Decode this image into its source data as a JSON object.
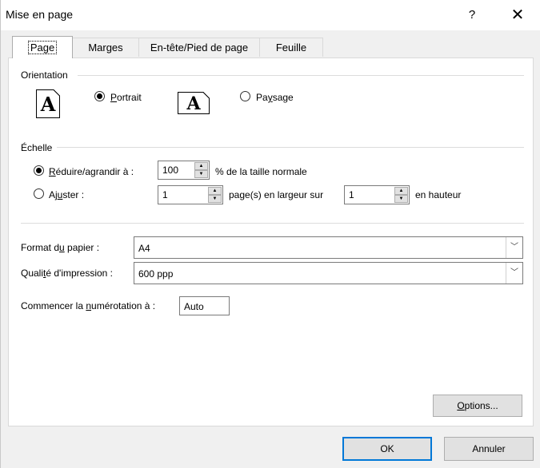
{
  "dialog": {
    "title": "Mise en page",
    "help_label": "?",
    "close_label": "✕"
  },
  "tabs": [
    {
      "label": "Page",
      "selected": true
    },
    {
      "label": "Marges",
      "selected": false
    },
    {
      "label": "En-tête/Pied de page",
      "selected": false
    },
    {
      "label": "Feuille",
      "selected": false
    }
  ],
  "orientation": {
    "group_label": "Orientation",
    "portrait": {
      "label_u": "P",
      "label_rest": "ortrait",
      "checked": true,
      "icon_glyph": "A"
    },
    "landscape": {
      "label_pre": "Pa",
      "label_u": "y",
      "label_rest": "sage",
      "checked": false,
      "icon_glyph": "A"
    }
  },
  "scale": {
    "group_label": "Échelle",
    "reduce": {
      "label_u": "R",
      "label_rest": "éduire/agrandir à :",
      "checked": true,
      "value": "100",
      "suffix": "% de la taille normale"
    },
    "fit": {
      "label_pre": "Aj",
      "label_u": "u",
      "label_rest": "ster :",
      "checked": false,
      "width_value": "1",
      "width_suffix": "page(s) en largeur sur",
      "height_value": "1",
      "height_suffix": "en hauteur"
    }
  },
  "paper": {
    "format_label_pre": "Format d",
    "format_label_u": "u",
    "format_label_rest": " papier :",
    "format_value": "A4",
    "quality_label_pre": "Quali",
    "quality_label_u": "t",
    "quality_label_rest": "é d'impression :",
    "quality_value": "600 ppp",
    "numbering_label_pre": "Commencer la ",
    "numbering_label_u": "n",
    "numbering_label_rest": "umérotation à :",
    "numbering_value": "Auto"
  },
  "buttons": {
    "options_u": "O",
    "options_rest": "ptions...",
    "ok": "OK",
    "cancel": "Annuler"
  }
}
